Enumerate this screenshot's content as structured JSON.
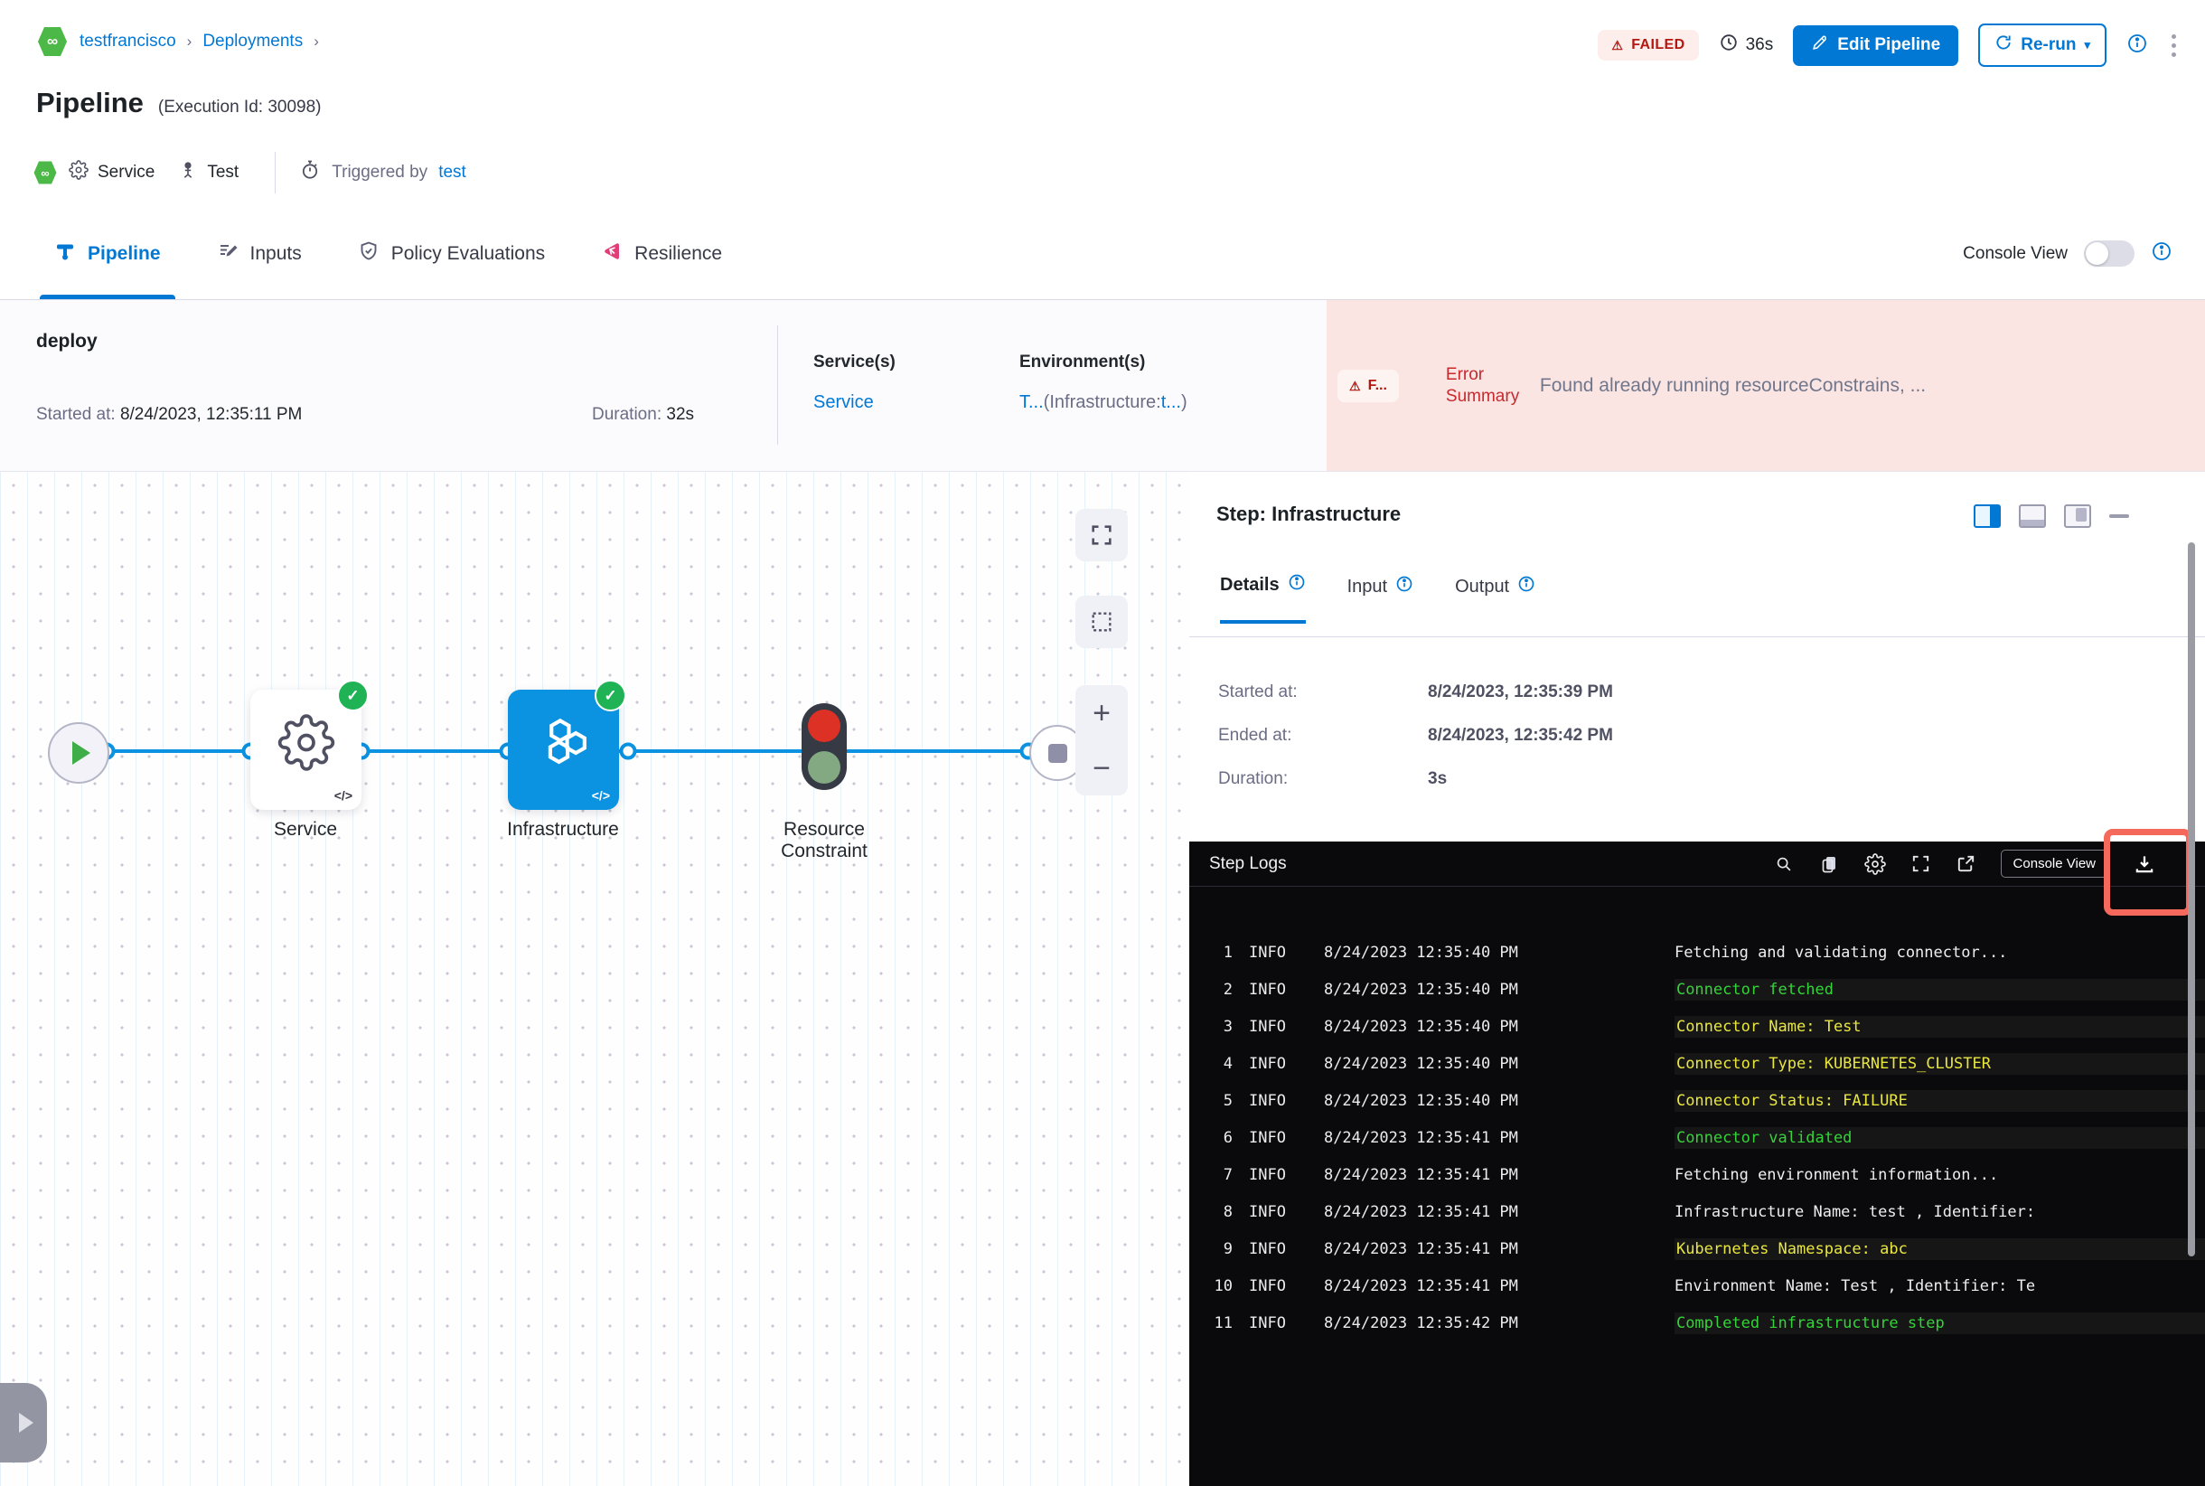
{
  "colors": {
    "primary_blue": "#0278d5",
    "node_blue": "#0b92e1",
    "success_green": "#1fb356",
    "failed_red": "#b41710",
    "error_bg": "#fbe5e2",
    "log_green": "#35d339",
    "log_yellow": "#e9e73f",
    "annotation_red": "#f4695c"
  },
  "breadcrumb": {
    "project": "testfrancisco",
    "section": "Deployments"
  },
  "header": {
    "title": "Pipeline",
    "execution_id": "(Execution Id: 30098)",
    "status": "FAILED",
    "elapsed": "36s",
    "edit_button": "Edit Pipeline",
    "rerun_button": "Re-run",
    "meta": {
      "service": "Service",
      "trigger_type": "Test",
      "triggered_by_label": "Triggered by",
      "triggered_by_user": "test"
    }
  },
  "tabs": [
    {
      "label": "Pipeline",
      "active": true
    },
    {
      "label": "Inputs",
      "active": false
    },
    {
      "label": "Policy Evaluations",
      "active": false
    },
    {
      "label": "Resilience",
      "active": false
    }
  ],
  "console_view": {
    "label": "Console View"
  },
  "summary": {
    "stage": "deploy",
    "started_label": "Started at:",
    "started": "8/24/2023, 12:35:11 PM",
    "duration_label": "Duration:",
    "duration": "32s",
    "services_label": "Service(s)",
    "service": "Service",
    "environments_label": "Environment(s)",
    "environment": {
      "env": "T...",
      "infra_prefix": "(Infrastructure:",
      "infra": "t...",
      "suffix": ")"
    },
    "error": {
      "badge": "F...",
      "label": "Error Summary",
      "message": "Found already running resourceConstrains, ..."
    }
  },
  "graph": {
    "nodes": [
      {
        "label": "Service"
      },
      {
        "label": "Infrastructure"
      },
      {
        "label": "Resource Constraint"
      }
    ]
  },
  "step_panel": {
    "title": "Step: Infrastructure",
    "tabs": [
      {
        "label": "Details"
      },
      {
        "label": "Input"
      },
      {
        "label": "Output"
      }
    ],
    "details": {
      "started_label": "Started at:",
      "started": "8/24/2023, 12:35:39 PM",
      "ended_label": "Ended at:",
      "ended": "8/24/2023, 12:35:42 PM",
      "duration_label": "Duration:",
      "duration": "3s"
    }
  },
  "logs": {
    "title": "Step Logs",
    "console_view_button": "Console View",
    "rows": [
      {
        "num": "1",
        "level": "INFO",
        "time": "8/24/2023 12:35:40 PM",
        "message": "Fetching and validating connector...",
        "color": "white"
      },
      {
        "num": "2",
        "level": "INFO",
        "time": "8/24/2023 12:35:40 PM",
        "message": "Connector fetched",
        "color": "green"
      },
      {
        "num": "3",
        "level": "INFO",
        "time": "8/24/2023 12:35:40 PM",
        "message": "Connector Name: Test",
        "color": "yellow"
      },
      {
        "num": "4",
        "level": "INFO",
        "time": "8/24/2023 12:35:40 PM",
        "message": "Connector Type: KUBERNETES_CLUSTER",
        "color": "yellow"
      },
      {
        "num": "5",
        "level": "INFO",
        "time": "8/24/2023 12:35:40 PM",
        "message": "Connector Status: FAILURE",
        "color": "yellow"
      },
      {
        "num": "6",
        "level": "INFO",
        "time": "8/24/2023 12:35:41 PM",
        "message": "Connector validated",
        "color": "green"
      },
      {
        "num": "7",
        "level": "INFO",
        "time": "8/24/2023 12:35:41 PM",
        "message": "Fetching environment information...",
        "color": "white"
      },
      {
        "num": "8",
        "level": "INFO",
        "time": "8/24/2023 12:35:41 PM",
        "message": "Infrastructure Name: test , Identifier:",
        "color": "white"
      },
      {
        "num": "9",
        "level": "INFO",
        "time": "8/24/2023 12:35:41 PM",
        "message": "Kubernetes Namespace: abc",
        "color": "yellow"
      },
      {
        "num": "10",
        "level": "INFO",
        "time": "8/24/2023 12:35:41 PM",
        "message": "Environment Name: Test , Identifier: Te",
        "color": "white"
      },
      {
        "num": "11",
        "level": "INFO",
        "time": "8/24/2023 12:35:42 PM",
        "message": "Completed infrastructure step",
        "color": "green"
      }
    ]
  }
}
